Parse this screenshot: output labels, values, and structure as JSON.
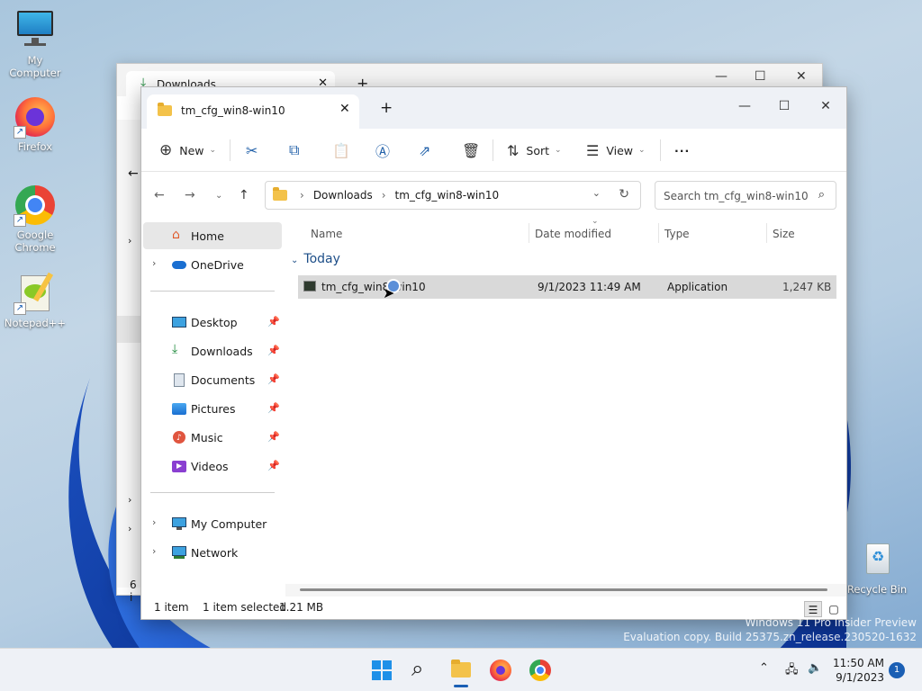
{
  "desktop": {
    "icons": [
      {
        "label": "My Computer"
      },
      {
        "label": "Firefox"
      },
      {
        "label": "Google Chrome"
      },
      {
        "label": "Notepad++"
      },
      {
        "label": "Recycle Bin"
      }
    ]
  },
  "back_window": {
    "tab_title": "Downloads",
    "footer_partial": "6 i"
  },
  "window": {
    "tab_title": "tm_cfg_win8-win10",
    "toolbar": {
      "new_label": "New",
      "sort_label": "Sort",
      "view_label": "View",
      "more_label": "···"
    },
    "breadcrumb": [
      "Downloads",
      "tm_cfg_win8-win10"
    ],
    "search_placeholder": "Search tm_cfg_win8-win10",
    "sidebar": {
      "home": "Home",
      "onedrive": "OneDrive",
      "quick": [
        "Desktop",
        "Downloads",
        "Documents",
        "Pictures",
        "Music",
        "Videos"
      ],
      "my_computer": "My Computer",
      "network": "Network"
    },
    "columns": [
      "Name",
      "Date modified",
      "Type",
      "Size"
    ],
    "group_label": "Today",
    "files": [
      {
        "name": "tm_cfg_win8-win10",
        "date": "9/1/2023 11:49 AM",
        "type": "Application",
        "size": "1,247 KB"
      }
    ],
    "status": {
      "count": "1 item",
      "selected": "1 item selected",
      "size": "1.21 MB"
    }
  },
  "watermark": {
    "line1": "Windows 11 Pro Insider Preview",
    "line2": "Evaluation copy. Build 25375.zn_release.230520-1632"
  },
  "taskbar": {
    "time": "11:50 AM",
    "date": "9/1/2023",
    "notifications": "1"
  },
  "colors": {
    "accent": "#1a5fb4",
    "selection": "#d9d9d9",
    "group_text": "#1d4e88"
  }
}
